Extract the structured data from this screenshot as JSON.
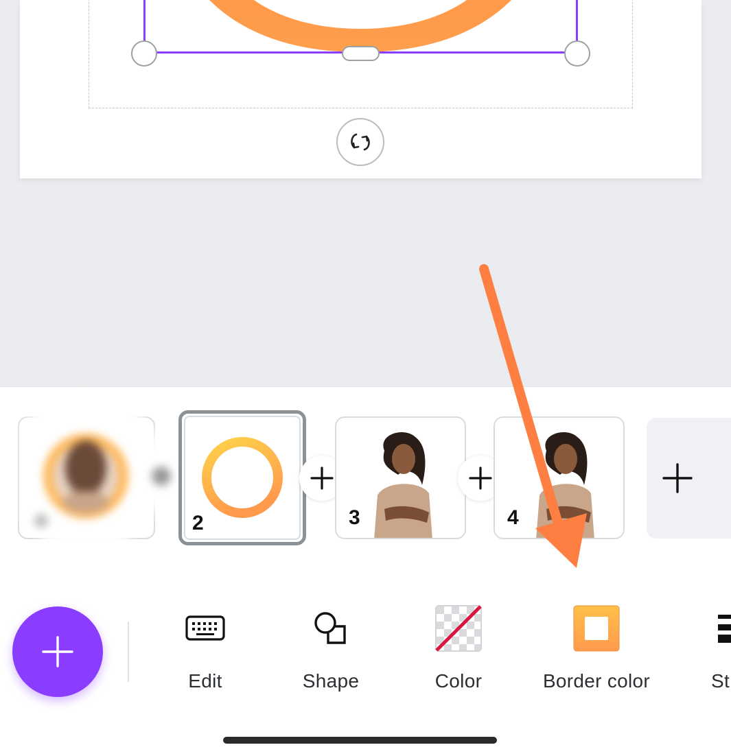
{
  "pages": [
    {
      "number": "",
      "state": "blurred"
    },
    {
      "number": "2",
      "state": "selected"
    },
    {
      "number": "3",
      "state": "normal"
    },
    {
      "number": "4",
      "state": "normal"
    }
  ],
  "toolbar": {
    "add_icon": "plus-icon",
    "tools": [
      {
        "label": "Edit",
        "icon": "keyboard-icon"
      },
      {
        "label": "Shape",
        "icon": "shape-icon"
      },
      {
        "label": "Color",
        "icon": "no-color-icon"
      },
      {
        "label": "Border color",
        "icon": "border-color-icon"
      },
      {
        "label": "St",
        "icon": "stroke-style-icon"
      }
    ]
  },
  "colors": {
    "accent": "#8b3dff",
    "ring_gradient_start": "#ffd24a",
    "ring_gradient_end": "#ff9a4d",
    "annotation_arrow": "#ff7f42",
    "border_swatch": "#ffa94d"
  }
}
